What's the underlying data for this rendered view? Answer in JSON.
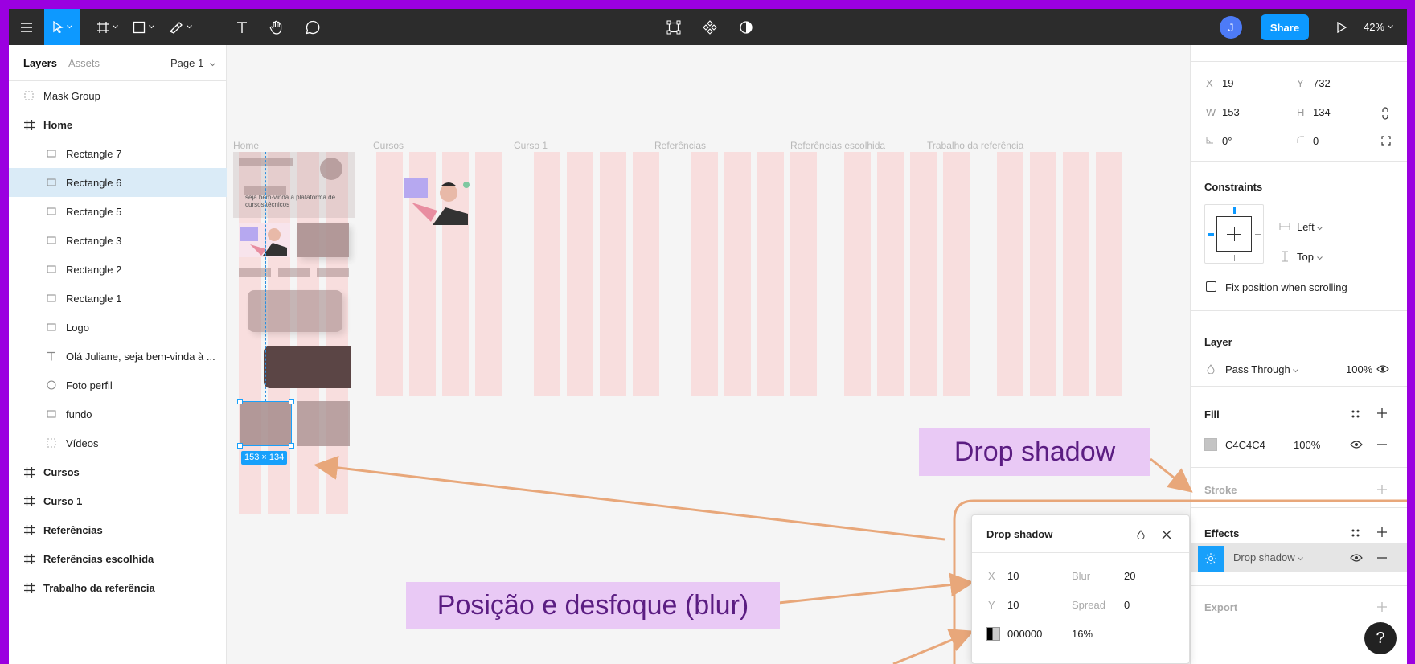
{
  "toolbar": {
    "zoom": "42%",
    "share": "Share",
    "avatar_initial": "J"
  },
  "left_panel": {
    "tabs": [
      "Layers",
      "Assets"
    ],
    "page": "Page 1",
    "layers": [
      {
        "label": "Mask Group",
        "kind": "mask"
      },
      {
        "label": "Home",
        "kind": "frame"
      },
      {
        "label": "Rectangle 7",
        "kind": "rect"
      },
      {
        "label": "Rectangle 6",
        "kind": "rect",
        "selected": true
      },
      {
        "label": "Rectangle 5",
        "kind": "rect"
      },
      {
        "label": "Rectangle 3",
        "kind": "rect"
      },
      {
        "label": "Rectangle 2",
        "kind": "rect"
      },
      {
        "label": "Rectangle 1",
        "kind": "rect"
      },
      {
        "label": "Logo",
        "kind": "rect"
      },
      {
        "label": "Olá Juliane, seja bem-vinda à ...",
        "kind": "text"
      },
      {
        "label": "Foto perfil",
        "kind": "ellipse"
      },
      {
        "label": "fundo",
        "kind": "rect"
      },
      {
        "label": "Vídeos",
        "kind": "mask"
      },
      {
        "label": "Cursos",
        "kind": "frame"
      },
      {
        "label": "Curso 1",
        "kind": "frame"
      },
      {
        "label": "Referências",
        "kind": "frame"
      },
      {
        "label": "Referências escolhida",
        "kind": "frame"
      },
      {
        "label": "Trabalho da referência",
        "kind": "frame"
      }
    ]
  },
  "canvas": {
    "frame_titles": [
      "Home",
      "Cursos",
      "Curso 1",
      "Referências",
      "Referências escolhida",
      "Trabalho da referência"
    ],
    "welcome_text": "seja bem-vinda à plataforma de cursos técnicos",
    "selection_size": "153 × 134"
  },
  "right_panel": {
    "x_label": "X",
    "x": "19",
    "y_label": "Y",
    "y": "732",
    "w_label": "W",
    "w": "153",
    "h_label": "H",
    "h": "134",
    "rotation": "0°",
    "radius": "0",
    "constraints_title": "Constraints",
    "constraint_h": "Left",
    "constraint_v": "Top",
    "fix_position": "Fix position when scrolling",
    "layer_title": "Layer",
    "blend": "Pass Through",
    "layer_opacity": "100%",
    "fill_title": "Fill",
    "fill_hex": "C4C4C4",
    "fill_color": "#c4c4c4",
    "fill_opacity": "100%",
    "stroke_title": "Stroke",
    "effects_title": "Effects",
    "effect_name": "Drop shadow",
    "export_title": "Export"
  },
  "popup": {
    "title": "Drop shadow",
    "x_label": "X",
    "x": "10",
    "y_label": "Y",
    "y": "10",
    "blur_label": "Blur",
    "blur": "20",
    "spread_label": "Spread",
    "spread": "0",
    "color": "000000",
    "opacity": "16%"
  },
  "annotations": {
    "drop_shadow": "Drop shadow",
    "position_blur": "Posição e desfoque (blur)"
  },
  "help": "?"
}
